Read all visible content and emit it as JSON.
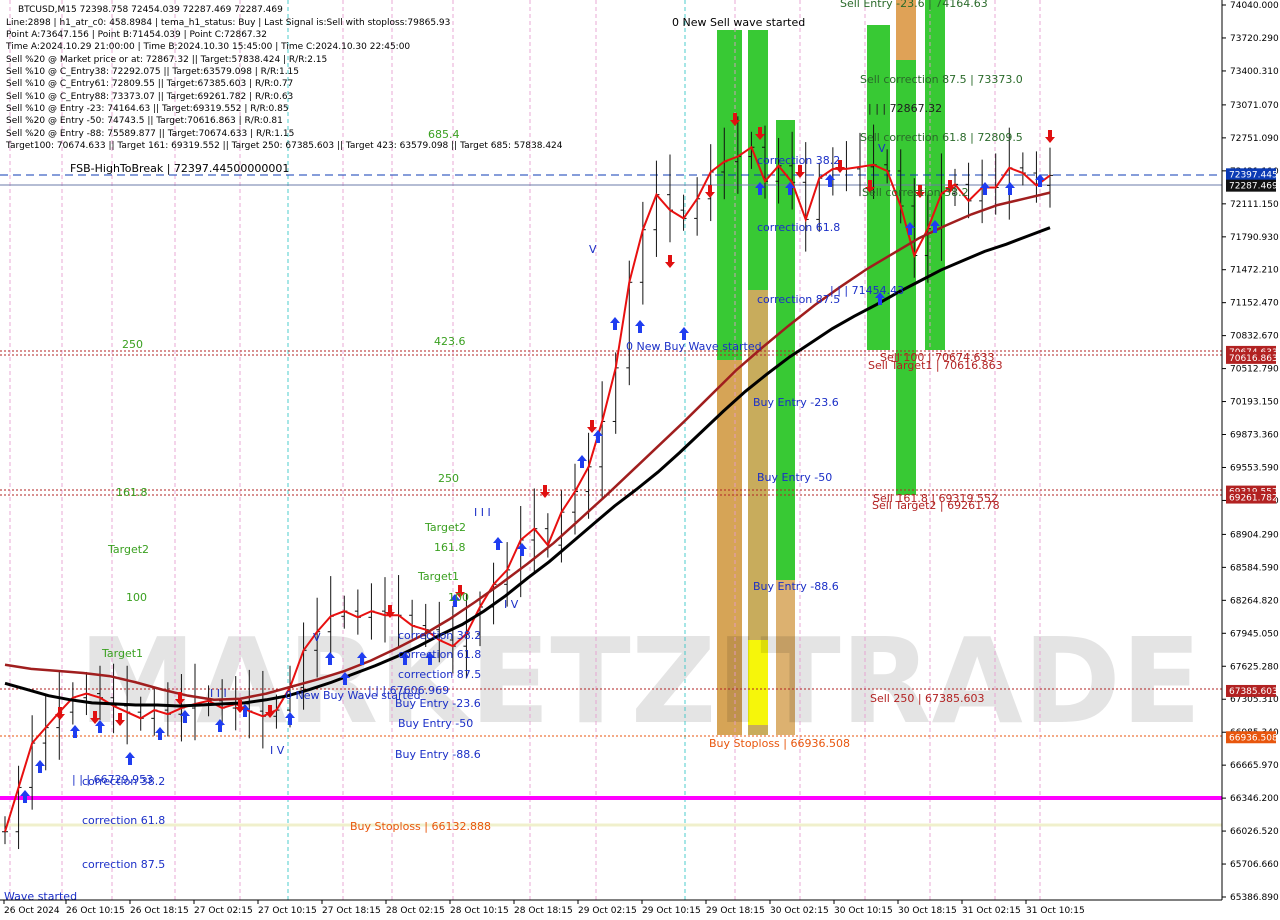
{
  "header": {
    "title": "BTCUSD,M15  72398.758 72454.039 72287.469 72287.469",
    "lines": [
      "Line:2898 | h1_atr_c0: 458.8984 | tema_h1_status: Buy | Last Signal is:Sell with stoploss:79865.93",
      "Point A:73647.156 | Point B:71454.039 | Point C:72867.32",
      "Time A:2024.10.29 21:00:00 | Time B:2024.10.30 15:45:00 | Time C:2024.10.30 22:45:00",
      "Sell %20 @ Market price or at: 72867.32 || Target:57838.424 | R/R:2.15",
      "Sell %10 @ C_Entry38: 72292.075 || Target:63579.098 | R/R:1.15",
      "Sell %10 @ C_Entry61: 72809.55 || Target:67385.603 | R/R:0.77",
      "Sell %10 @ C_Entry88: 73373.07 || Target:69261.782 | R/R:0.63",
      "Sell %10 @ Entry -23: 74164.63 || Target:69319.552 | R/R:0.85",
      "Sell %20 @ Entry -50: 74743.5 || Target:70616.863 | R/R:0.81",
      "Sell %20 @ Entry -88: 75589.877 || Target:70674.633 | R/R:1.15",
      "Target100: 70674.633 || Target 161: 69319.552 || Target 250: 67385.603 || Target 423: 63579.098 || Target 685: 57838.424"
    ]
  },
  "watermark": "MARKETZITRADE",
  "chart_data": {
    "type": "candlestick",
    "symbol": "BTCUSD",
    "timeframe": "M15",
    "ylim": [
      65386.89,
      74040.0
    ],
    "y_ticks": [
      "74040.000",
      "73720.290",
      "73400.310",
      "73071.070",
      "72751.090",
      "72431.110",
      "72111.150",
      "71790.930",
      "71472.210",
      "71152.470",
      "70832.670",
      "70512.790",
      "70193.150",
      "69873.360",
      "69553.590",
      "69233.810",
      "68904.290",
      "68584.590",
      "68264.820",
      "67945.050",
      "67625.280",
      "67305.310",
      "66985.340",
      "66665.970",
      "66346.200",
      "66026.520",
      "65706.660",
      "65386.890"
    ],
    "x_ticks": [
      "26 Oct 2024",
      "26 Oct 10:15",
      "26 Oct 18:15",
      "27 Oct 02:15",
      "27 Oct 10:15",
      "27 Oct 18:15",
      "28 Oct 02:15",
      "28 Oct 10:15",
      "28 Oct 18:15",
      "29 Oct 02:15",
      "29 Oct 10:15",
      "29 Oct 18:15",
      "30 Oct 02:15",
      "30 Oct 10:15",
      "30 Oct 18:15",
      "31 Oct 02:15",
      "31 Oct 10:15"
    ],
    "price_tags": [
      {
        "label": "72397.445",
        "color": "#0c3bb5"
      },
      {
        "label": "72287.469",
        "color": "#111111"
      },
      {
        "label": "70674.633",
        "color": "#b22222"
      },
      {
        "label": "70616.863",
        "color": "#b22222"
      },
      {
        "label": "69319.552",
        "color": "#b22222"
      },
      {
        "label": "69261.782",
        "color": "#b22222"
      },
      {
        "label": "67385.603",
        "color": "#b22222"
      },
      {
        "label": "66936.508",
        "color": "#e8560d"
      }
    ],
    "series": [
      {
        "name": "close",
        "values": [
          66020,
          66450,
          66880,
          67030,
          67180,
          67320,
          67360,
          67320,
          67240,
          67180,
          67120,
          67200,
          67160,
          67220,
          67260,
          67290,
          67220,
          67260,
          67190,
          67140,
          67200,
          67420,
          67780,
          67960,
          68110,
          68160,
          68100,
          68160,
          68120,
          68120,
          68020,
          67980,
          67880,
          67820,
          67940,
          68200,
          68420,
          68560,
          68850,
          68960,
          68800,
          69120,
          69320,
          69560,
          70000,
          70520,
          71350,
          71860,
          72200,
          72050,
          71970,
          72160,
          72420,
          72520,
          72570,
          72660,
          72330,
          72480,
          72320,
          71960,
          72360,
          72450,
          72450,
          72470,
          72490,
          72430,
          72090,
          71610,
          71870,
          72210,
          72300,
          72140,
          72270,
          72270,
          72460,
          72410,
          72290,
          72387
        ]
      },
      {
        "name": "ma_black",
        "values": [
          67460,
          67400,
          67340,
          67300,
          67270,
          67260,
          67250,
          67250,
          67240,
          67250,
          67260,
          67270,
          67300,
          67340,
          67400,
          67470,
          67550,
          67630,
          67720,
          67820,
          67930,
          68030,
          68160,
          68310,
          68480,
          68640,
          68820,
          69000,
          69180,
          69340,
          69510,
          69700,
          69900,
          70100,
          70290,
          70460,
          70620,
          70760,
          70900,
          71020,
          71130,
          71250,
          71360,
          71470,
          71560,
          71650,
          71720,
          71800,
          71880
        ]
      },
      {
        "name": "ma_brown",
        "values": [
          67640,
          67600,
          67580,
          67560,
          67530,
          67470,
          67400,
          67340,
          67300,
          67310,
          67360,
          67430,
          67500,
          67580,
          67680,
          67800,
          67930,
          68080,
          68250,
          68430,
          68620,
          68820,
          69050,
          69280,
          69520,
          69760,
          70000,
          70250,
          70500,
          70720,
          70930,
          71130,
          71310,
          71480,
          71630,
          71780,
          71900,
          72010,
          72100,
          72160,
          72220
        ]
      }
    ]
  },
  "annotations": {
    "fsb": "FSB-HighToBreak | 72397.44500000001",
    "new_sell_wave": "0 New Sell wave started",
    "new_buy_wave_1": "0 New Buy Wave started",
    "new_buy_wave_2": "0 New Buy Wave started",
    "wave_started": "Wave started",
    "fib_685": "685.4",
    "fib_423_left": "423.6",
    "fib_250_left": "250",
    "fib_161_left": "161.8",
    "target2_left": "Target2",
    "fib_100_left": "100",
    "target1_left": "Target1",
    "fib_250_mid": "250",
    "target2_mid": "Target2",
    "fib_161_mid": "161.8",
    "target1_mid": "Target1",
    "fib_100_mid": "100",
    "corr_38_left": "correction 38.2",
    "corr_61_left": "correction 61.8",
    "corr_87_left": "correction 87.5",
    "level_left": "| | | 66729.953",
    "corr_38_mid": "correction 38.2",
    "corr_61_mid": "correction 61.8",
    "corr_87_mid": "correction 87.5",
    "level_mid": "| | | 67606.969",
    "buy_23_mid": "Buy Entry -23.6",
    "buy_50_mid": "Buy Entry -50",
    "buy_88_mid": "Buy Entry -88.6",
    "corr_38_right": "correction 38.2",
    "corr_61_right": "correction 61.8",
    "corr_87_right": "correction 87.5",
    "buy_23_right": "Buy Entry -23.6",
    "buy_50_right": "Buy Entry -50",
    "buy_88_right": "Buy Entry -88.6",
    "buy_stoploss_1": "Buy Stoploss | 66132.888",
    "buy_stoploss_2": "Buy Stoploss | 66936.508",
    "sell_entry_top": "Sell Entry -23.6 | 74164.63",
    "sell_corr_87": "Sell correction 87.5 | 73373.0",
    "level_c": "| | | 72867.32",
    "sell_corr_61": "Sell correction 61.8 | 72809.5",
    "sell_corr_38": "Sell correction 38.2",
    "level_b": "| | | 71454.43",
    "sell_100": "Sell 100 | 70674.633",
    "sell_target1": "Sell Target1 | 70616.863",
    "sell_161": "Sell 161.8 | 69319.552",
    "sell_target2": "Sell Target2 | 69261.78",
    "sell_250": "Sell  250 | 67385.603",
    "wave_v": "V",
    "wave_iv": "I V",
    "wave_iii": "I I I"
  },
  "colors": {
    "background": "#ffffff",
    "buy_arrow": "#1f3df0",
    "sell_arrow": "#e01010",
    "magenta_line": "#ff00ff",
    "green_zone": "#22c31e",
    "orange_zone": "#e8a05a",
    "yellow_zone": "#f6f60a",
    "ma_black": "#000000",
    "ma_brown": "#a01e1e",
    "tema_red": "#e81010",
    "target_red": "#b22222",
    "stop_orange": "#e8560d",
    "fib_green": "#3aa020",
    "corr_blue": "#1b2fc7"
  }
}
